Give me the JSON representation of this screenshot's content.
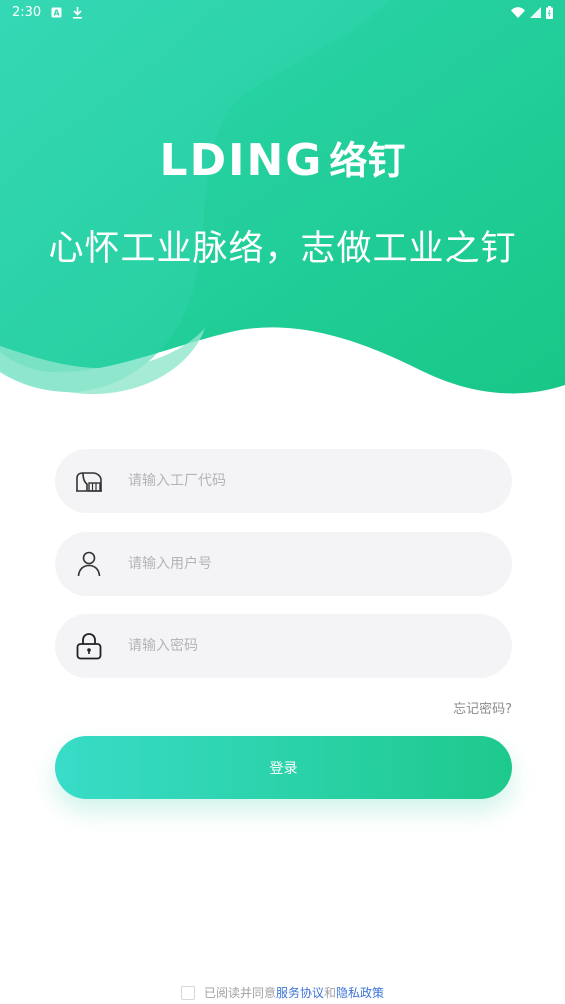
{
  "status_bar": {
    "time": "2:30",
    "icons": [
      "notification-a-icon",
      "download-icon",
      "wifi-icon",
      "signal-icon",
      "battery-icon"
    ]
  },
  "brand": {
    "logo_latin": "LDING",
    "logo_cn": "络钉",
    "slogan": "心怀工业脉络，志做工业之钉"
  },
  "form": {
    "factory_code_placeholder": "请输入工厂代码",
    "username_placeholder": "请输入用户号",
    "password_placeholder": "请输入密码",
    "factory_icon": "factory-icon",
    "user_icon": "user-icon",
    "lock_icon": "lock-icon"
  },
  "forgot_password": "忘记密码?",
  "login_button": "登录",
  "agreement": {
    "prefix": "已阅读并同意",
    "service_link": "服务协议",
    "conjunction": "和",
    "privacy_link": "隐私政策"
  },
  "colors": {
    "gradient_start": "#38dcc8",
    "gradient_end": "#1ec98c",
    "link": "#3c74d8",
    "field_bg": "#f4f4f6"
  }
}
